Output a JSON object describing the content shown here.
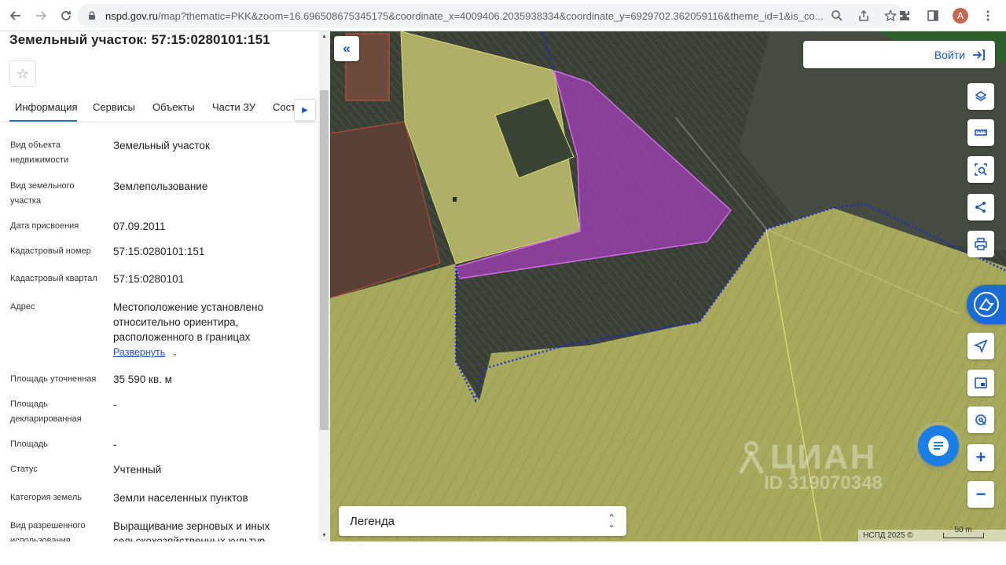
{
  "browser": {
    "url_host": "nspd.gov.ru",
    "url_rest": "/map?thematic=PKK&zoom=16.696508675345175&coordinate_x=4009406.2035938334&coordinate_y=6929702.362059116&theme_id=1&is_co...",
    "avatar_letter": "А"
  },
  "panel": {
    "title": "Земельный участок: 57:15:0280101:151",
    "tabs": [
      "Информация",
      "Сервисы",
      "Объекты",
      "Части ЗУ",
      "Состав"
    ],
    "rows": [
      {
        "label": "Вид объекта недвижимости",
        "value": "Земельный участок"
      },
      {
        "label": "Вид земельного участка",
        "value": "Землепользование"
      },
      {
        "label": "Дата присвоения",
        "value": "07.09.2011"
      },
      {
        "label": "Кадастровый номер",
        "value": "57:15:0280101:151"
      },
      {
        "label": "Кадастровый квартал",
        "value": "57:15:0280101"
      },
      {
        "label": "Адрес",
        "value": "Местоположение установлено относительно ориентира, расположенного в границах"
      },
      {
        "label": "Площадь уточненная",
        "value": "35 590 кв. м"
      },
      {
        "label": "Площадь декларированная",
        "value": "-"
      },
      {
        "label": "Площадь",
        "value": "-"
      },
      {
        "label": "Статус",
        "value": "Учтенный"
      },
      {
        "label": "Категория земель",
        "value": "Земли населенных пунктов"
      },
      {
        "label": "Вид разрешенного использования",
        "value": "Выращивание зерновых и иных сельскохозяйственных культур"
      }
    ],
    "expand_label": "Развернуть"
  },
  "map": {
    "login_label": "Войти",
    "legend_label": "Легенда",
    "attribution": "НСПД 2025 ©",
    "scale_label": "50 m",
    "watermark_brand": "ЦИАН",
    "watermark_id": "ID 319070348",
    "colors": {
      "parcel_fill": "#c8c96a",
      "selected_fill": "#a23fb8",
      "boundary_dotted": "#1a2ccf",
      "accent": "#1a56c7"
    }
  }
}
